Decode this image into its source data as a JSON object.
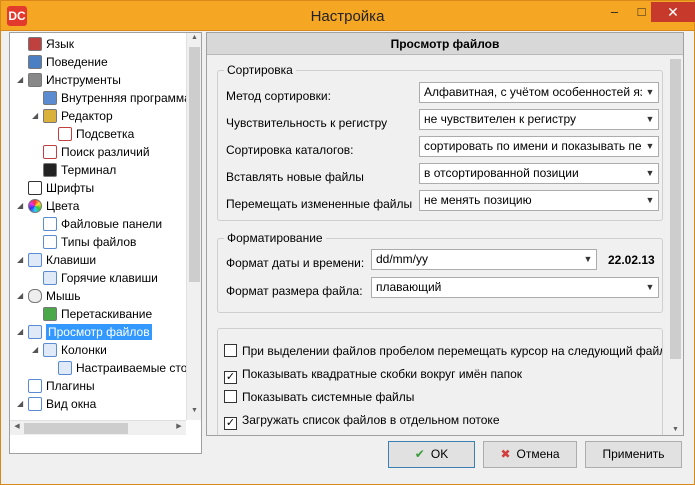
{
  "window": {
    "title": "Настройка",
    "app_icon": "DC",
    "minimize_glyph": "–",
    "maximize_glyph": "□",
    "close_glyph": "✕"
  },
  "tree": {
    "items": [
      {
        "label": "Язык",
        "icon": "flag-icon",
        "color": "#c04040"
      },
      {
        "label": "Поведение",
        "icon": "behavior-icon",
        "color": "#4a7fc4"
      },
      {
        "label": "Инструменты",
        "icon": "tools-icon",
        "color": "#888888"
      },
      {
        "label": "Внутренняя программа",
        "icon": "book-icon",
        "color": "#5b8bd0"
      },
      {
        "label": "Редактор",
        "icon": "editor-icon",
        "color": "#d9b13b"
      },
      {
        "label": "Подсветка",
        "icon": "highlight-icon",
        "color": "#c04040"
      },
      {
        "label": "Поиск различий",
        "icon": "diff-icon",
        "color": "#c04040"
      },
      {
        "label": "Терминал",
        "icon": "terminal-icon",
        "color": "#222222"
      },
      {
        "label": "Шрифты",
        "icon": "font-icon",
        "color": "#333333"
      },
      {
        "label": "Цвета",
        "icon": "color-wheel-icon",
        "color": "#e05a9a"
      },
      {
        "label": "Файловые панели",
        "icon": "panels-icon",
        "color": "#5b8bd0"
      },
      {
        "label": "Типы файлов",
        "icon": "file-types-icon",
        "color": "#5b8bd0"
      },
      {
        "label": "Клавиши",
        "icon": "keyboard-icon",
        "color": "#5b8bd0"
      },
      {
        "label": "Горячие клавиши",
        "icon": "hotkeys-icon",
        "color": "#5b8bd0"
      },
      {
        "label": "Мышь",
        "icon": "mouse-icon",
        "color": "#888888"
      },
      {
        "label": "Перетаскивание",
        "icon": "drag-drop-icon",
        "color": "#4aa84a"
      },
      {
        "label": "Просмотр файлов",
        "icon": "file-view-icon",
        "color": "#5b8bd0"
      },
      {
        "label": "Колонки",
        "icon": "columns-icon",
        "color": "#5b8bd0"
      },
      {
        "label": "Настраиваемые столбцы",
        "icon": "custom-columns-icon",
        "color": "#5b8bd0"
      },
      {
        "label": "Плагины",
        "icon": "plugins-icon",
        "color": "#5b8bd0"
      },
      {
        "label": "Вид окна",
        "icon": "window-view-icon",
        "color": "#5b8bd0"
      }
    ],
    "expand_glyph": "◢",
    "scroll_up": "▲",
    "scroll_down": "▼",
    "scroll_left": "◀",
    "scroll_right": "▶"
  },
  "panel": {
    "title": "Просмотр файлов",
    "sorting": {
      "legend": "Сортировка",
      "rows": [
        {
          "label": "Метод сортировки:",
          "value": "Алфавитная, с учётом особенностей язы"
        },
        {
          "label": "Чувствительность к регистру",
          "value": "не чувствителен к регистру"
        },
        {
          "label": "Сортировка каталогов:",
          "value": "сортировать по имени и показывать пе"
        },
        {
          "label": "Вставлять новые файлы",
          "value": "в отсортированной позиции"
        },
        {
          "label": "Перемещать измененные файлы",
          "value": "не менять позицию"
        }
      ]
    },
    "formatting": {
      "legend": "Форматирование",
      "date_label": "Формат даты и времени:",
      "date_value": "dd/mm/yy",
      "date_sample": "22.02.13",
      "size_label": "Формат размера файла:",
      "size_value": "плавающий"
    },
    "checks": [
      {
        "label": "При выделении файлов пробелом перемещать курсор на следующий файл",
        "checked": false
      },
      {
        "label": "Показывать квадратные скобки вокруг имён папок",
        "checked": true
      },
      {
        "label": "Показывать системные файлы",
        "checked": false
      },
      {
        "label": "Загружать список файлов в отдельном потоке",
        "checked": true
      }
    ],
    "dropdown_glyph": "▼"
  },
  "buttons": {
    "ok": "OK",
    "ok_icon": "✔",
    "cancel": "Отмена",
    "cancel_icon": "✖",
    "apply": "Применить"
  },
  "colors": {
    "title_bar": "#f5a623",
    "close_button": "#c7392b",
    "selection": "#3399ff"
  }
}
